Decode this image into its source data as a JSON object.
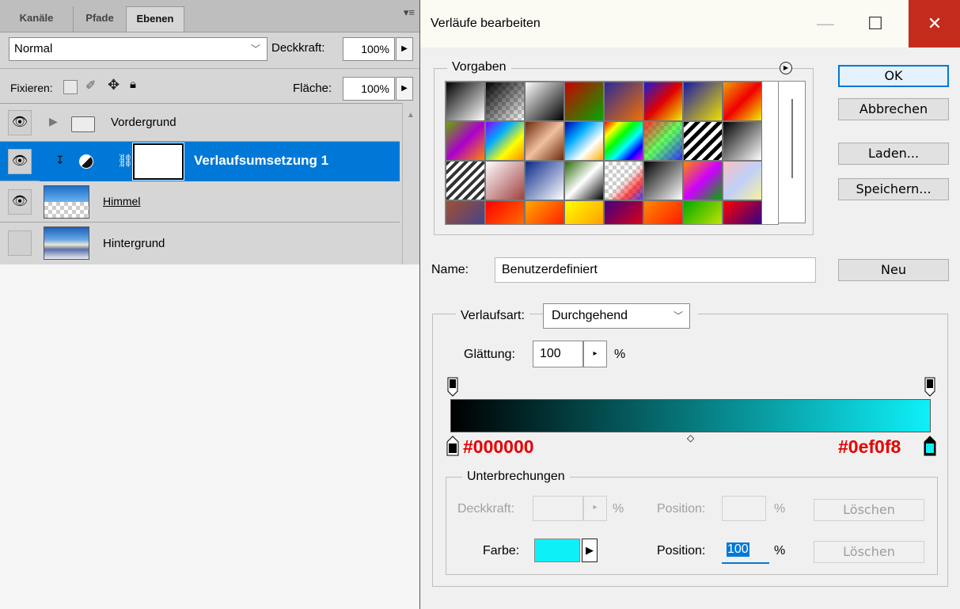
{
  "layers_panel": {
    "tabs": [
      "Kanäle",
      "Pfade",
      "Ebenen"
    ],
    "blend_mode": "Normal",
    "opacity_label": "Deckkraft:",
    "opacity_value": "100%",
    "lock_label": "Fixieren:",
    "fill_label": "Fläche:",
    "fill_value": "100%",
    "layers": [
      {
        "name": "Vordergrund",
        "visible": true,
        "type": "group"
      },
      {
        "name": "Verlaufsumsetzung 1",
        "visible": true,
        "type": "adjustment",
        "selected": true
      },
      {
        "name": "Himmel",
        "visible": true,
        "type": "image"
      },
      {
        "name": "Hintergrund",
        "visible": false,
        "type": "image"
      }
    ]
  },
  "dialog": {
    "title": "Verläufe bearbeiten",
    "presets_label": "Vorgaben",
    "buttons": {
      "ok": "OK",
      "cancel": "Abbrechen",
      "load": "Laden...",
      "save": "Speichern...",
      "new": "Neu"
    },
    "name_label": "Name:",
    "name_value": "Benutzerdefiniert",
    "gradient_type_label": "Verlaufsart:",
    "gradient_type_value": "Durchgehend",
    "smoothness_label": "Glättung:",
    "smoothness_value": "100",
    "smoothness_unit": "%",
    "gradient_start_color": "#000000",
    "gradient_end_color": "#0ef0f8",
    "hex_start": "#000000",
    "hex_end": "#0ef0f8",
    "stops_label": "Unterbrechungen",
    "stops": {
      "opacity_label": "Deckkraft:",
      "opacity_unit": "%",
      "opacity_position_label": "Position:",
      "opacity_position_unit": "%",
      "delete1": "Löschen",
      "color_label": "Farbe:",
      "color_value": "#0ef0f8",
      "position_label": "Position:",
      "position_value": "100",
      "position_unit": "%",
      "delete2": "Löschen"
    }
  },
  "colors": {
    "selection_blue": "#0078d7",
    "close_red": "#c42b1c",
    "annotation_red": "#e60000"
  }
}
